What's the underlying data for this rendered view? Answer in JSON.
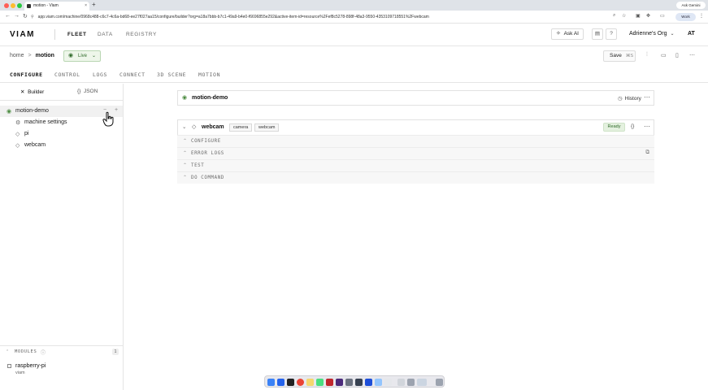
{
  "browser": {
    "tab_title": "motion - Viam",
    "tab_close": "×",
    "new_tab": "+",
    "url": "app.viam.com/machine/0968c488-c6c7-4c6a-bd68-ee27f027aa15/configure/builder?org=a18a7bbb-b7c1-49a9-b4e0-f6696855e292&active-item-id=resource%2Fef8c5278-898f-48a3-9550-4353109718551%2Fwebcam",
    "ask_gemini": "Ask Gemini",
    "profile": "Work",
    "traffic_colors": [
      "#ff5f57",
      "#febc2e",
      "#28c840"
    ]
  },
  "header": {
    "logo": "VIAM",
    "nav": [
      "FLEET",
      "DATA",
      "REGISTRY"
    ],
    "active_nav": "FLEET",
    "ask_ai": "Ask AI",
    "org_name": "Adrienne's Org",
    "initials": "AT"
  },
  "machine_bar": {
    "breadcrumb_home": "home",
    "breadcrumb_sep": ">",
    "breadcrumb_current": "motion",
    "live_label": "Live",
    "save_label": "Save",
    "save_shortcut": "⌘S"
  },
  "tabs": [
    "CONFIGURE",
    "CONTROL",
    "LOGS",
    "CONNECT",
    "3D SCENE",
    "MOTION"
  ],
  "active_tab": "CONFIGURE",
  "sidebar": {
    "tabs": [
      "Builder",
      "JSON"
    ],
    "root": "motion-demo",
    "items": [
      {
        "label": "machine settings",
        "icon": "gear-icon"
      },
      {
        "label": "pi",
        "icon": "diamond-icon"
      },
      {
        "label": "webcam",
        "icon": "diamond-icon"
      }
    ],
    "modules_label": "MODULES",
    "modules_count": "1",
    "module": {
      "name": "raspberry-pi",
      "org": "viam"
    }
  },
  "main": {
    "machine_card_title": "motion-demo",
    "history_label": "History",
    "component": {
      "name": "webcam",
      "type_chip": "camera",
      "model_chip": "webcam",
      "status": "Ready",
      "json_toggle": "{}"
    },
    "sections": [
      "CONFIGURE",
      "ERROR LOGS",
      "TEST",
      "DO COMMAND"
    ]
  },
  "colors": {
    "live_green": "#2f6a2a",
    "ready_bg": "#e4f1df",
    "border": "#e2e2e2"
  }
}
